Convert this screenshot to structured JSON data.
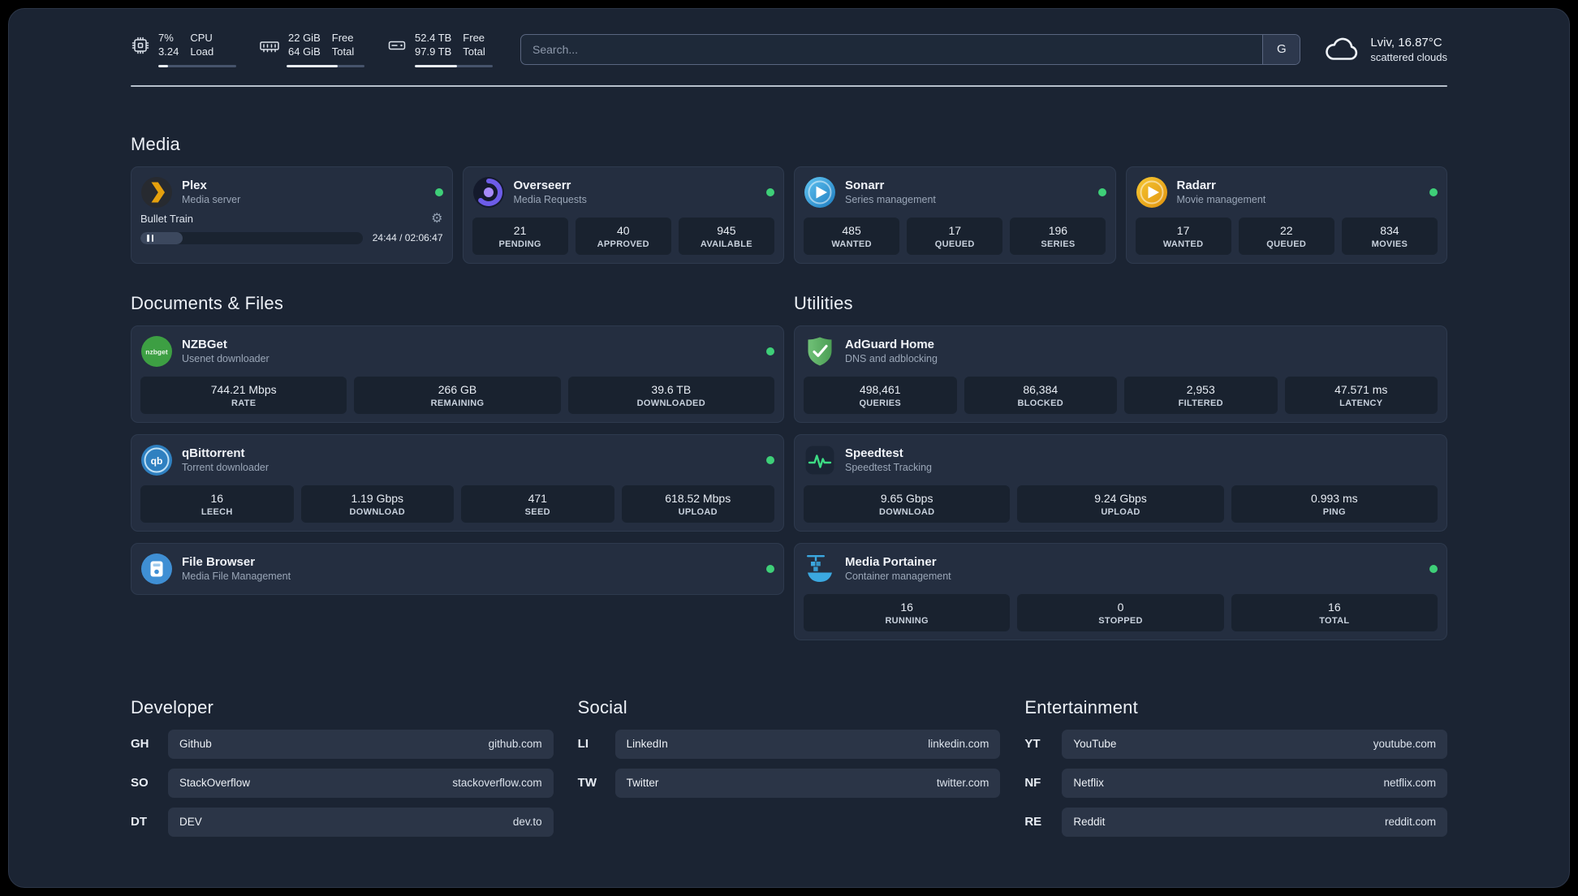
{
  "colors": {
    "background": "#1b2433",
    "card": "#242e40",
    "stat_box": "#19222f",
    "status_online": "#3ecf78",
    "accent_plex": "#e5a00d",
    "accent_speedtest": "#3ddc84"
  },
  "topbar": {
    "system_stats": [
      {
        "icon": "cpu-icon",
        "primary": "7%",
        "secondary": "3.24",
        "primary_label": "CPU",
        "secondary_label": "Load",
        "progress_pct": 12
      },
      {
        "icon": "ram-icon",
        "primary": "22 GiB",
        "secondary": "64 GiB",
        "primary_label": "Free",
        "secondary_label": "Total",
        "progress_pct": 66
      },
      {
        "icon": "disk-icon",
        "primary": "52.4 TB",
        "secondary": "97.9 TB",
        "primary_label": "Free",
        "secondary_label": "Total",
        "progress_pct": 54
      }
    ],
    "search": {
      "placeholder": "Search...",
      "engine_button": "G"
    },
    "weather": {
      "icon": "cloud-icon",
      "location": "Lviv, 16.87°C",
      "condition": "scattered clouds"
    }
  },
  "groups": {
    "media": {
      "title": "Media",
      "cards": [
        {
          "name": "Plex",
          "description": "Media server",
          "icon": "plex-icon",
          "online": true,
          "now_playing": {
            "title": "Bullet Train",
            "time_display": "24:44 / 02:06:47",
            "progress_pct": 19,
            "pause_icon": "pause-icon",
            "gear_icon": "gear-icon"
          }
        },
        {
          "name": "Overseerr",
          "description": "Media Requests",
          "icon": "overseerr-icon",
          "online": true,
          "stats": [
            {
              "value": "21",
              "label": "PENDING"
            },
            {
              "value": "40",
              "label": "APPROVED"
            },
            {
              "value": "945",
              "label": "AVAILABLE"
            }
          ]
        },
        {
          "name": "Sonarr",
          "description": "Series management",
          "icon": "sonarr-icon",
          "online": true,
          "stats": [
            {
              "value": "485",
              "label": "WANTED"
            },
            {
              "value": "17",
              "label": "QUEUED"
            },
            {
              "value": "196",
              "label": "SERIES"
            }
          ]
        },
        {
          "name": "Radarr",
          "description": "Movie management",
          "icon": "radarr-icon",
          "online": true,
          "stats": [
            {
              "value": "17",
              "label": "WANTED"
            },
            {
              "value": "22",
              "label": "QUEUED"
            },
            {
              "value": "834",
              "label": "MOVIES"
            }
          ]
        }
      ]
    },
    "documents": {
      "title": "Documents & Files",
      "cards": [
        {
          "name": "NZBGet",
          "description": "Usenet downloader",
          "icon": "nzbget-icon",
          "online": true,
          "stats": [
            {
              "value": "744.21 Mbps",
              "label": "RATE"
            },
            {
              "value": "266 GB",
              "label": "REMAINING"
            },
            {
              "value": "39.6 TB",
              "label": "DOWNLOADED"
            }
          ]
        },
        {
          "name": "qBittorrent",
          "description": "Torrent downloader",
          "icon": "qbittorrent-icon",
          "online": true,
          "stats": [
            {
              "value": "16",
              "label": "LEECH"
            },
            {
              "value": "1.19 Gbps",
              "label": "DOWNLOAD"
            },
            {
              "value": "471",
              "label": "SEED"
            },
            {
              "value": "618.52 Mbps",
              "label": "UPLOAD"
            }
          ]
        },
        {
          "name": "File Browser",
          "description": "Media File Management",
          "icon": "filebrowser-icon",
          "online": true
        }
      ]
    },
    "utilities": {
      "title": "Utilities",
      "cards": [
        {
          "name": "AdGuard Home",
          "description": "DNS and adblocking",
          "icon": "adguard-icon",
          "online": false,
          "stats": [
            {
              "value": "498,461",
              "label": "QUERIES"
            },
            {
              "value": "86,384",
              "label": "BLOCKED"
            },
            {
              "value": "2,953",
              "label": "FILTERED"
            },
            {
              "value": "47.571 ms",
              "label": "LATENCY"
            }
          ]
        },
        {
          "name": "Speedtest",
          "description": "Speedtest Tracking",
          "icon": "speedtest-icon",
          "online": false,
          "stats": [
            {
              "value": "9.65 Gbps",
              "label": "DOWNLOAD"
            },
            {
              "value": "9.24 Gbps",
              "label": "UPLOAD"
            },
            {
              "value": "0.993 ms",
              "label": "PING"
            }
          ]
        },
        {
          "name": "Media Portainer",
          "description": "Container management",
          "icon": "portainer-icon",
          "online": true,
          "stats": [
            {
              "value": "16",
              "label": "RUNNING"
            },
            {
              "value": "0",
              "label": "STOPPED"
            },
            {
              "value": "16",
              "label": "TOTAL"
            }
          ]
        }
      ]
    }
  },
  "bookmarks": [
    {
      "title": "Developer",
      "links": [
        {
          "abbr": "GH",
          "name": "Github",
          "url": "github.com"
        },
        {
          "abbr": "SO",
          "name": "StackOverflow",
          "url": "stackoverflow.com"
        },
        {
          "abbr": "DT",
          "name": "DEV",
          "url": "dev.to"
        }
      ]
    },
    {
      "title": "Social",
      "links": [
        {
          "abbr": "LI",
          "name": "LinkedIn",
          "url": "linkedin.com"
        },
        {
          "abbr": "TW",
          "name": "Twitter",
          "url": "twitter.com"
        }
      ]
    },
    {
      "title": "Entertainment",
      "links": [
        {
          "abbr": "YT",
          "name": "YouTube",
          "url": "youtube.com"
        },
        {
          "abbr": "NF",
          "name": "Netflix",
          "url": "netflix.com"
        },
        {
          "abbr": "RE",
          "name": "Reddit",
          "url": "reddit.com"
        }
      ]
    }
  ]
}
